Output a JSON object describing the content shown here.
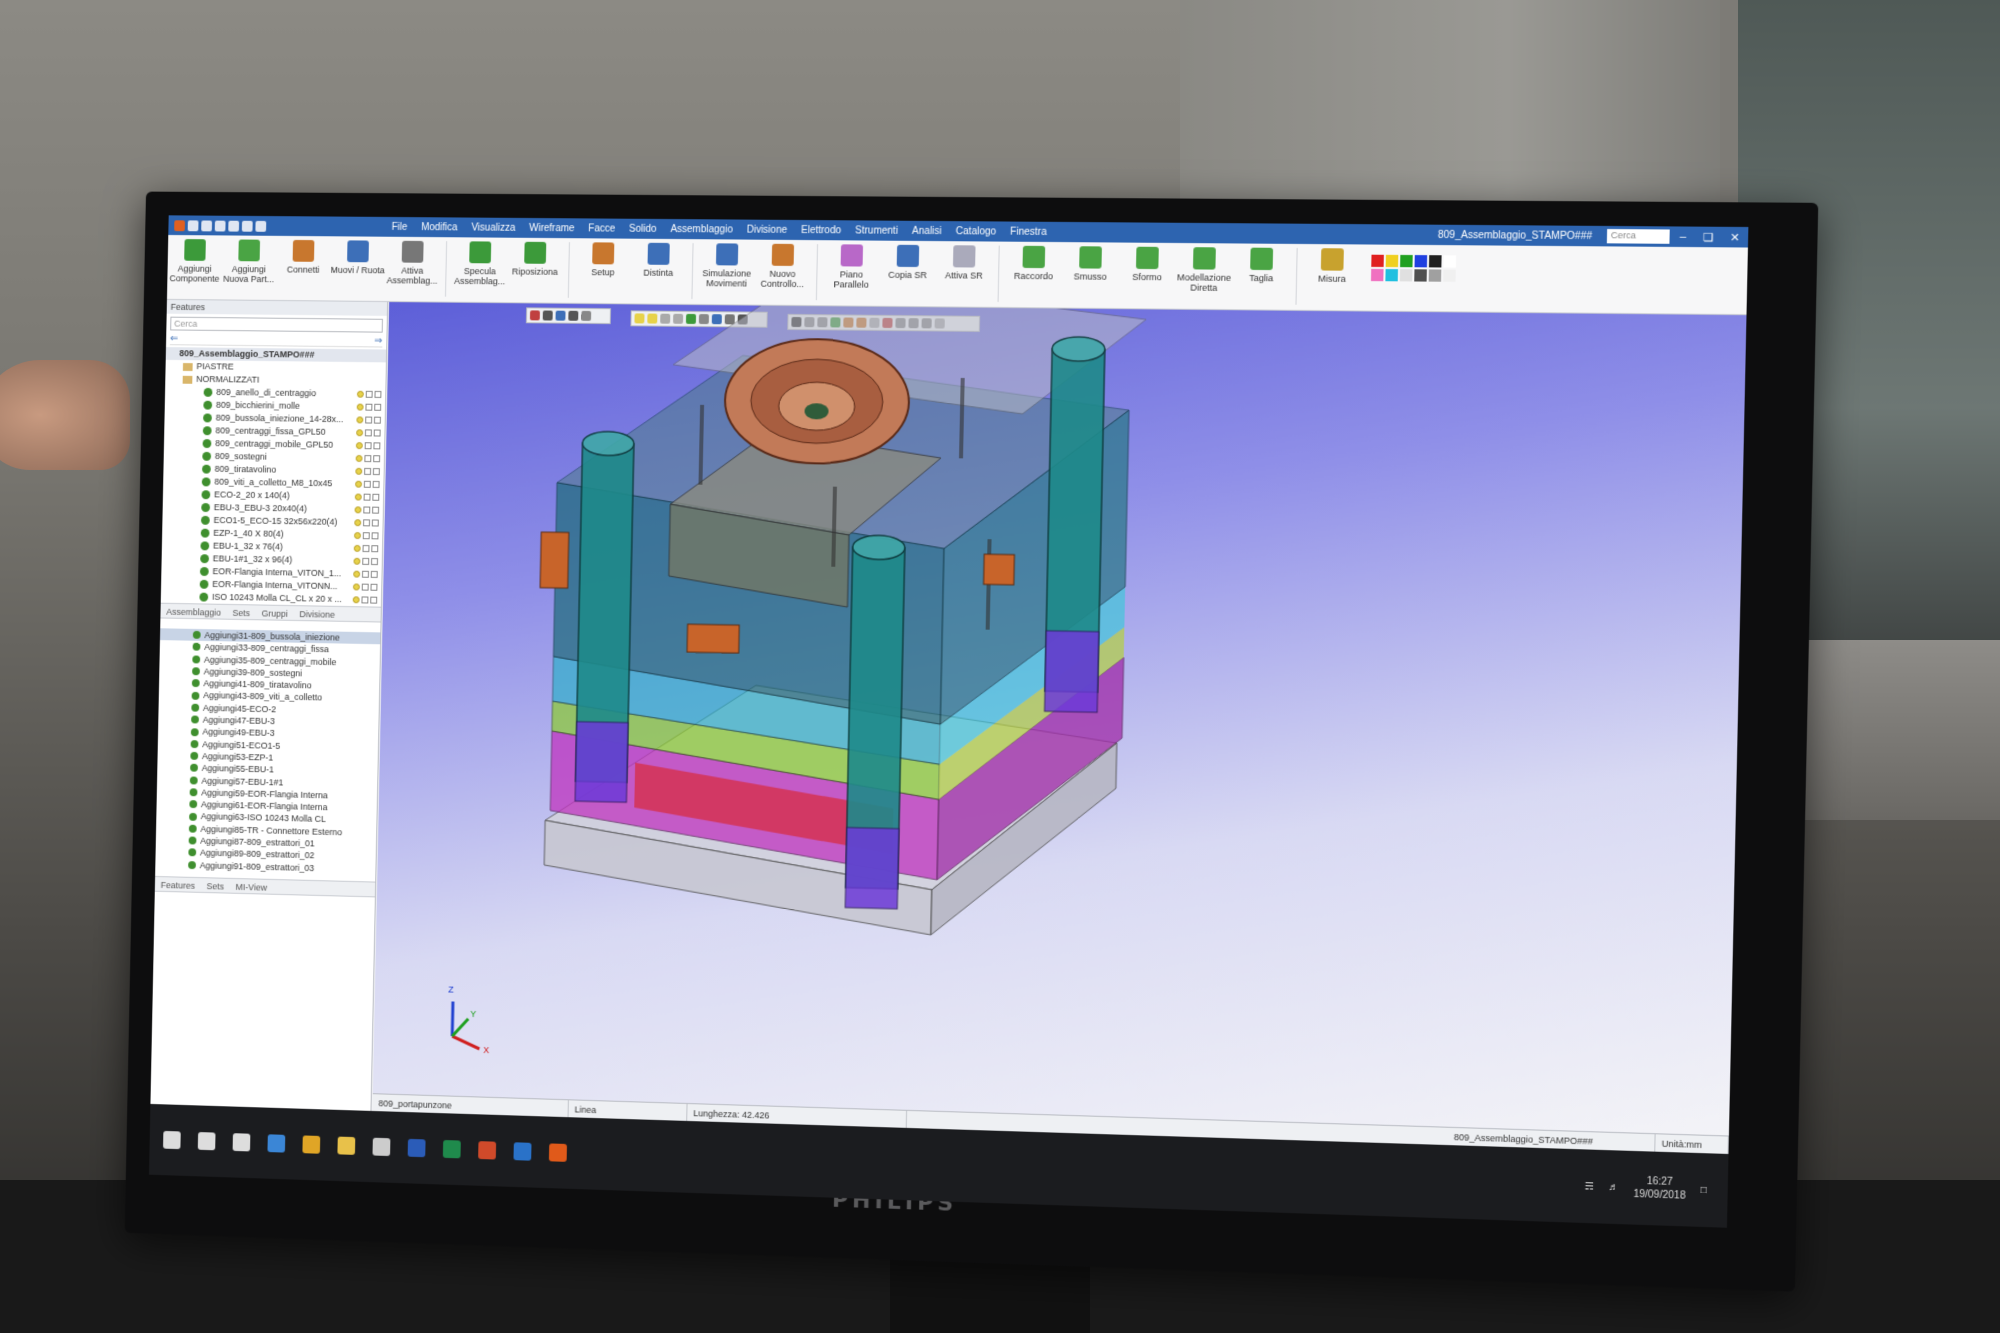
{
  "app": {
    "document_title": "809_Assemblaggio_STAMPO###",
    "search_placeholder": "Cerca",
    "menus": [
      "File",
      "Modifica",
      "Visualizza",
      "Wireframe",
      "Facce",
      "Solido",
      "Assemblaggio",
      "Divisione",
      "Elettrodo",
      "Strumenti",
      "Analisi",
      "Catalogo",
      "Finestra"
    ]
  },
  "ribbon": {
    "buttons": [
      {
        "label": "Aggiungi Componente",
        "icon": "add-component-icon",
        "color": "#3c9a3a"
      },
      {
        "label": "Aggiungi Nuova Part...",
        "icon": "add-new-part-icon",
        "color": "#4aa444"
      },
      {
        "label": "Connetti",
        "icon": "connect-icon",
        "color": "#c8772e"
      },
      {
        "label": "Muovi / Ruota",
        "icon": "move-rotate-icon",
        "color": "#3d6fb8"
      },
      {
        "label": "Attiva Assemblag...",
        "icon": "activate-assembly-icon",
        "color": "#777"
      },
      {
        "label": "Specula Assemblag...",
        "icon": "mirror-assembly-icon",
        "color": "#3c9a3a"
      },
      {
        "label": "Riposiziona",
        "icon": "reposition-icon",
        "color": "#3c9a3a"
      },
      {
        "label": "Setup",
        "icon": "setup-icon",
        "color": "#c8772e"
      },
      {
        "label": "Distinta",
        "icon": "bom-icon",
        "color": "#3d6fb8"
      },
      {
        "label": "Simulazione Movimenti",
        "icon": "motion-simulation-icon",
        "color": "#3d6fb8"
      },
      {
        "label": "Nuovo Controllo...",
        "icon": "new-check-icon",
        "color": "#c8772e"
      },
      {
        "label": "Piano Parallelo",
        "icon": "parallel-plane-icon",
        "color": "#b868c8"
      },
      {
        "label": "Copia SR",
        "icon": "copy-sr-icon",
        "color": "#3d6fb8"
      },
      {
        "label": "Attiva SR",
        "icon": "activate-sr-icon",
        "color": "#aab"
      },
      {
        "label": "Raccordo",
        "icon": "fillet-icon",
        "color": "#4aa444"
      },
      {
        "label": "Smusso",
        "icon": "chamfer-icon",
        "color": "#4aa444"
      },
      {
        "label": "Sformo",
        "icon": "draft-icon",
        "color": "#4aa444"
      },
      {
        "label": "Modellazione Diretta",
        "icon": "direct-modeling-icon",
        "color": "#4aa444"
      },
      {
        "label": "Taglia",
        "icon": "cut-icon",
        "color": "#4aa444"
      },
      {
        "label": "Misura",
        "icon": "measure-icon",
        "color": "#c8a22e"
      }
    ],
    "palette": [
      "#e02020",
      "#f0d020",
      "#20a020",
      "#2040e0",
      "#202020",
      "#ffffff",
      "#f070c0",
      "#20c0e0",
      "#e0e0e0",
      "#505050",
      "#a0a0a0",
      "#f0f0f0"
    ]
  },
  "features_panel": {
    "title": "Features",
    "search_placeholder": "Cerca",
    "root": "809_Assemblaggio_STAMPO###",
    "folders": [
      "PIASTRE",
      "NORMALIZZATI"
    ],
    "items": [
      "809_anello_di_centraggio",
      "809_bicchierini_molle",
      "809_bussola_iniezione_14-28x...",
      "809_centraggi_fissa_GPL50",
      "809_centraggi_mobile_GPL50",
      "809_sostegni",
      "809_tiratavolino",
      "809_viti_a_colletto_M8_10x45",
      "ECO-2_20 x 140(4)",
      "EBU-3_EBU-3 20x40(4)",
      "ECO1-5_ECO-15 32x56x220(4)",
      "EZP-1_40 X 80(4)",
      "EBU-1_32 x 76(4)",
      "EBU-1#1_32 x 96(4)",
      "EOR-Flangia Interna_VITON_1...",
      "EOR-Flangia Interna_VITONN...",
      "ISO 10243 Molla CL_CL x 20 x ..."
    ],
    "tabs": [
      "Assemblaggio",
      "Sets",
      "Gruppi",
      "Divisione"
    ]
  },
  "history_panel": {
    "items": [
      "Aggiungi31-809_bussola_iniezione",
      "Aggiungi33-809_centraggi_fissa",
      "Aggiungi35-809_centraggi_mobile",
      "Aggiungi39-809_sostegni",
      "Aggiungi41-809_tiratavolino",
      "Aggiungi43-809_viti_a_colletto",
      "Aggiungi45-ECO-2",
      "Aggiungi47-EBU-3",
      "Aggiungi49-EBU-3",
      "Aggiungi51-ECO1-5",
      "Aggiungi53-EZP-1",
      "Aggiungi55-EBU-1",
      "Aggiungi57-EBU-1#1",
      "Aggiungi59-EOR-Flangia Interna",
      "Aggiungi61-EOR-Flangia Interna",
      "Aggiungi63-ISO 10243 Molla CL",
      "Aggiungi85-TR - Connettore Esterno",
      "Aggiungi87-809_estrattori_01",
      "Aggiungi89-809_estrattori_02",
      "Aggiungi91-809_estrattori_03"
    ],
    "selected_index": 0,
    "tabs": [
      "Features",
      "Sets",
      "MI-View"
    ]
  },
  "viewport": {
    "axis_labels": {
      "x": "X",
      "y": "Y",
      "z": "Z"
    }
  },
  "statusbar": {
    "part": "809_portapunzone",
    "entity": "Linea",
    "length": "Lunghezza: 42.426",
    "file": "809_Assemblaggio_STAMPO###",
    "units": "Unità:mm"
  },
  "taskbar": {
    "time": "16:27",
    "date": "19/09/2018",
    "apps": [
      {
        "name": "start-icon",
        "color": "#dddddd"
      },
      {
        "name": "search-icon",
        "color": "#dddddd"
      },
      {
        "name": "task-view-icon",
        "color": "#dddddd"
      },
      {
        "name": "edge-icon",
        "color": "#3b86d6"
      },
      {
        "name": "chrome-icon",
        "color": "#e0a526"
      },
      {
        "name": "explorer-icon",
        "color": "#e8c14a"
      },
      {
        "name": "store-icon",
        "color": "#cccccc"
      },
      {
        "name": "word-icon",
        "color": "#2b5cb8"
      },
      {
        "name": "excel-icon",
        "color": "#1f8a4c"
      },
      {
        "name": "powerpoint-icon",
        "color": "#d04a2a"
      },
      {
        "name": "outlook-icon",
        "color": "#2a72c8"
      },
      {
        "name": "cad-app-icon",
        "color": "#e05a1a"
      }
    ]
  },
  "monitor": {
    "brand": "PHILIPS"
  }
}
